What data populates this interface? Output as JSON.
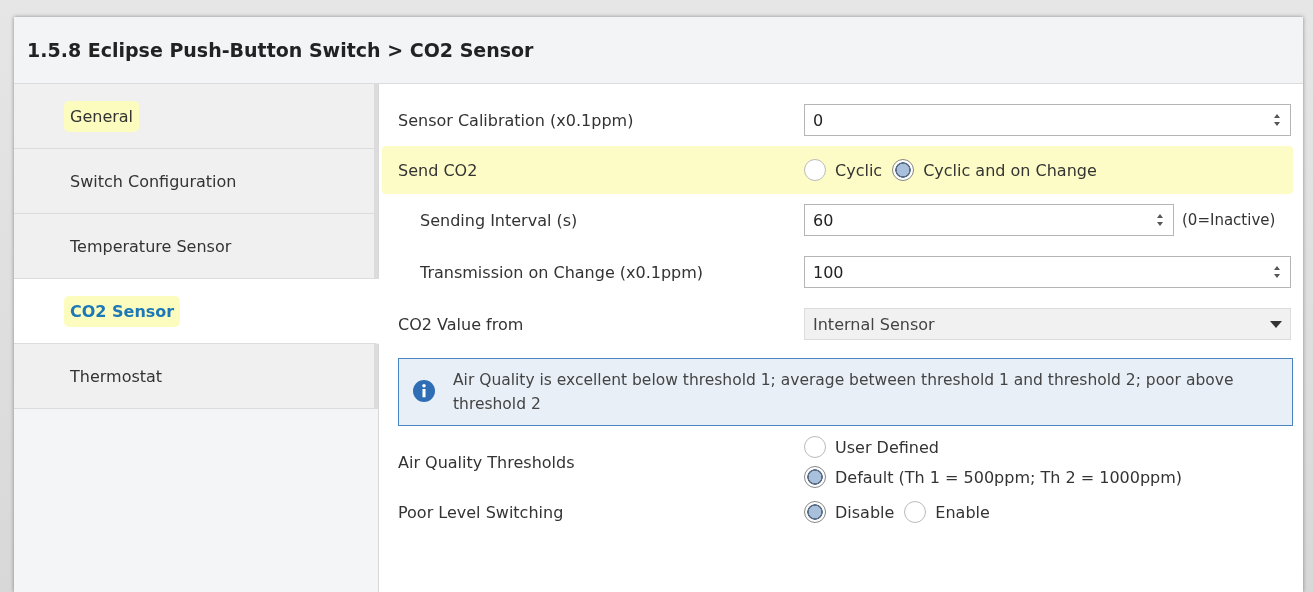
{
  "window": {
    "title": "1.5.8 Eclipse Push-Button Switch > CO2 Sensor"
  },
  "sidebar": {
    "items": [
      {
        "label": "General",
        "selected": false,
        "highlighted": true
      },
      {
        "label": "Switch Configuration",
        "selected": false,
        "highlighted": false
      },
      {
        "label": "Temperature Sensor",
        "selected": false,
        "highlighted": false
      },
      {
        "label": "CO2 Sensor",
        "selected": true,
        "highlighted": true
      },
      {
        "label": "Thermostat",
        "selected": false,
        "highlighted": false
      }
    ]
  },
  "rows": [
    {
      "kind": "spin",
      "label": "Sensor Calibration (x0.1ppm)",
      "value": "0",
      "indented": false,
      "highlighted": false
    },
    {
      "kind": "radio",
      "label": "Send CO2",
      "indented": false,
      "highlighted": true,
      "stacked": false,
      "options": [
        {
          "label": "Cyclic",
          "selected": false
        },
        {
          "label": "Cyclic and on Change",
          "selected": true
        }
      ]
    },
    {
      "kind": "spin",
      "label": "Sending Interval (s)",
      "value": "60",
      "suffix": "(0=Inactive)",
      "indented": true,
      "highlighted": false
    },
    {
      "kind": "spin",
      "label": "Transmission on Change (x0.1ppm)",
      "value": "100",
      "indented": true,
      "highlighted": false
    },
    {
      "kind": "dropdown",
      "label": "CO2 Value from",
      "value": "Internal Sensor",
      "indented": false,
      "highlighted": false
    },
    {
      "kind": "info",
      "text": "Air Quality is excellent below threshold 1; average between threshold 1 and threshold 2; poor above threshold 2"
    },
    {
      "kind": "radio",
      "label": "Air Quality Thresholds",
      "indented": false,
      "highlighted": false,
      "stacked": true,
      "options": [
        {
          "label": "User Defined",
          "selected": false
        },
        {
          "label": "Default (Th 1 = 500ppm; Th 2 = 1000ppm)",
          "selected": true
        }
      ]
    },
    {
      "kind": "radio",
      "label": "Poor Level Switching",
      "indented": false,
      "highlighted": false,
      "stacked": false,
      "options": [
        {
          "label": "Disable",
          "selected": true
        },
        {
          "label": "Enable",
          "selected": false
        }
      ]
    }
  ]
}
